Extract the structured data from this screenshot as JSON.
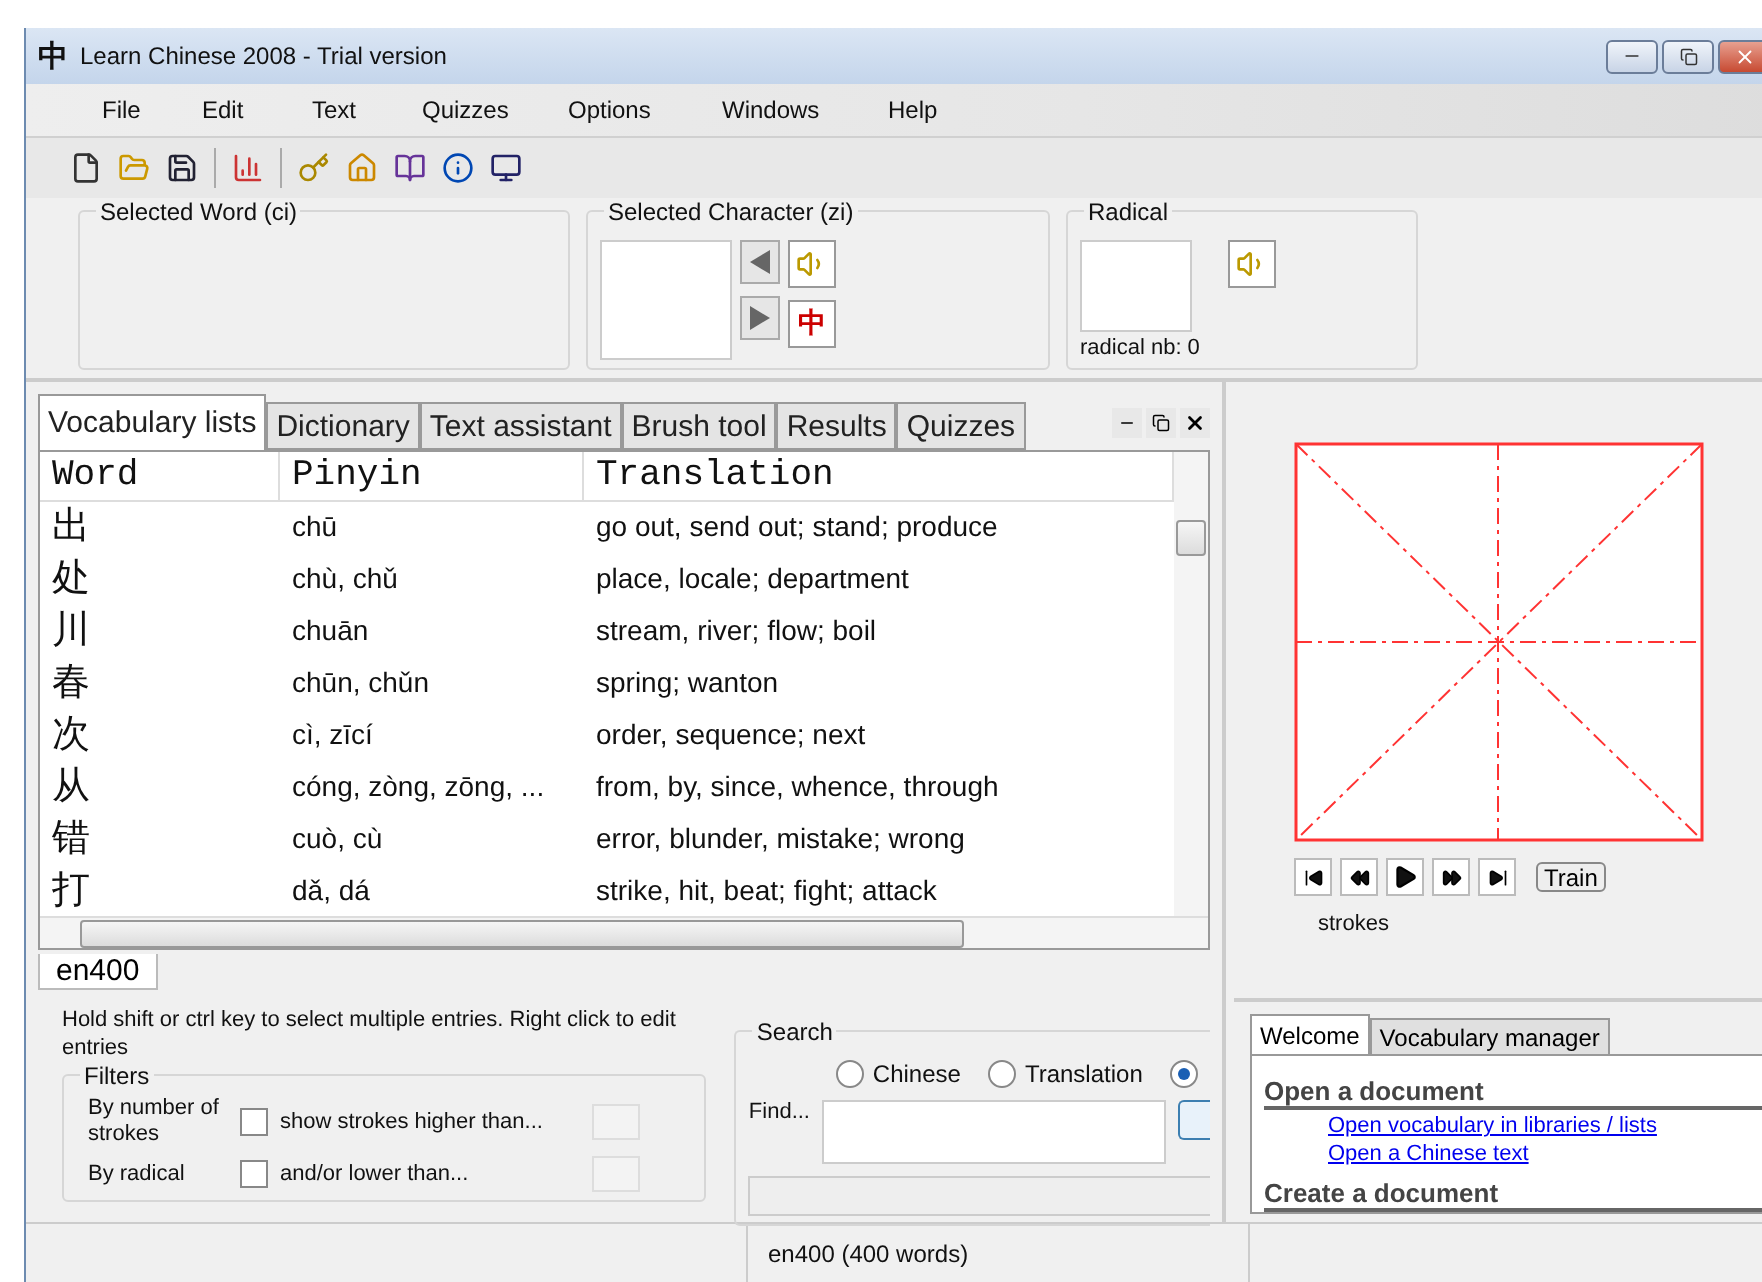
{
  "window": {
    "app_icon": "中",
    "title": "Learn Chinese 2008 - Trial version"
  },
  "menu": [
    "File",
    "Edit",
    "Text",
    "Quizzes",
    "Options",
    "Windows",
    "Help"
  ],
  "selection_panels": {
    "word_label": "Selected Word (ci)",
    "character_label": "Selected Character (zi)",
    "radical_label": "Radical",
    "radical_number": "radical nb: 0",
    "character_button": "中"
  },
  "tabs": [
    {
      "label": "Vocabulary lists",
      "selected": true
    },
    {
      "label": "Dictionary",
      "selected": false
    },
    {
      "label": "Text assistant",
      "selected": false
    },
    {
      "label": "Brush tool",
      "selected": false
    },
    {
      "label": "Results",
      "selected": false
    },
    {
      "label": "Quizzes",
      "selected": false
    }
  ],
  "table": {
    "columns": [
      "Word",
      "Pinyin",
      "Translation"
    ],
    "rows": [
      {
        "word": "出",
        "pinyin": "chū",
        "translation": "go out, send out; stand; produce"
      },
      {
        "word": "处",
        "pinyin": "chù, chǔ",
        "translation": "place, locale; department"
      },
      {
        "word": "川",
        "pinyin": "chuān",
        "translation": "stream, river; flow; boil"
      },
      {
        "word": "春",
        "pinyin": "chūn, chǔn",
        "translation": "spring; wanton"
      },
      {
        "word": "次",
        "pinyin": "cì, zīcí",
        "translation": "order, sequence; next"
      },
      {
        "word": "从",
        "pinyin": "cóng, zòng, zōng, ...",
        "translation": "from, by, since, whence, through"
      },
      {
        "word": "错",
        "pinyin": "cuò, cù",
        "translation": "error, blunder, mistake; wrong"
      },
      {
        "word": "打",
        "pinyin": "dǎ, dá",
        "translation": "strike, hit, beat; fight; attack"
      }
    ]
  },
  "list_tabs": [
    {
      "label": "en400",
      "selected": true
    }
  ],
  "hint": "Hold shift or ctrl key to select multiple entries. Right click to edit entries",
  "filters": {
    "title": "Filters",
    "options": [
      {
        "label": "By number of strokes",
        "checked": false
      },
      {
        "label": "By radical",
        "checked": false
      }
    ],
    "higher_label": "show strokes higher than...",
    "lower_label": "and/or lower than..."
  },
  "search": {
    "title": "Search",
    "options": [
      {
        "label": "Chinese",
        "selected": false
      },
      {
        "label": "Translation",
        "selected": false
      },
      {
        "selected": true
      }
    ],
    "find_label": "Find..."
  },
  "strokes": {
    "label": "strokes",
    "train_button": "Train"
  },
  "welcome": {
    "tabs": [
      {
        "label": "Welcome",
        "selected": true
      },
      {
        "label": "Vocabulary manager",
        "selected": false
      }
    ],
    "sections": [
      {
        "heading": "Open a document",
        "links": [
          "Open vocabulary in libraries / lists",
          "Open a Chinese text"
        ]
      },
      {
        "heading": "Create a document"
      }
    ]
  },
  "status_bar": "en400 (400 words)"
}
